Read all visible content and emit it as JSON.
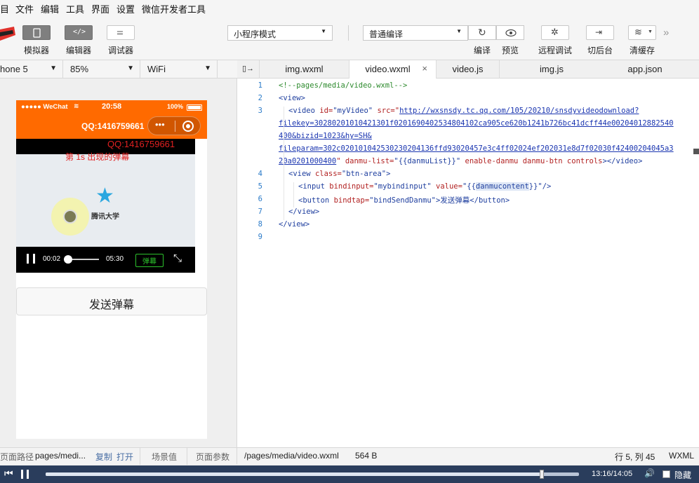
{
  "menubar": {
    "items": [
      "目",
      "文件",
      "编辑",
      "工具",
      "界面",
      "设置",
      "微信开发者工具"
    ]
  },
  "toolbar": {
    "simulator_label": "模拟器",
    "editor_label": "编辑器",
    "debugger_label": "调试器",
    "mode_select": "小程序模式",
    "compile_select": "普通编译",
    "compile_label": "编译",
    "preview_label": "预览",
    "remote_debug_label": "远程调试",
    "background_label": "切后台",
    "clear_cache_label": "清缓存"
  },
  "devbar": {
    "device": "hone 5",
    "zoom": "85%",
    "network": "WiFi"
  },
  "tabs": [
    "img.wxml",
    "video.wxml",
    "video.js",
    "img.js",
    "app.json"
  ],
  "phone": {
    "carrier": "●●●●● WeChat",
    "time": "20:58",
    "battery": "100%",
    "nav_title": "QQ:1416759661",
    "watermark": "QQ:1416759661",
    "danmu_text": "第 1s 出现的弹幕",
    "logo_text": "腾讯大学",
    "current_time": "00:02",
    "duration": "05:30",
    "danmu_btn": "弹幕",
    "send_button": "发送弹幕"
  },
  "editor": {
    "line_numbers": [
      "1",
      "2",
      "3",
      "4",
      "5",
      "6",
      "7",
      "8",
      "9"
    ],
    "l1": "<!--pages/media/video.wxml-->",
    "l2": "<view>",
    "l3_pre": "<video ",
    "l3_a1": "id=",
    "l3_v1": "\"myVideo\"",
    "l3_a2": " src=\"",
    "l3_url1": "http://wxsnsdy.tc.qq.com/105/20210/snsdyvideodownload?",
    "l3_url2": "filekey=30280201010421301f0201690402534804102ca905ce620b1241b726bc41dcff44e00204012882540",
    "l3_url3": "400&bizid=1023&hy=SH&",
    "l3_url4": "fileparam=302c020101042530230204136ffd93020457e3c4ff02024ef202031e8d7f02030f42400204045a3",
    "l3_url5": "20a0201000400",
    "l3_a3": "\" danmu-list=",
    "l3_v3": "\"{{danmuList}}\"",
    "l3_a4": " enable-danmu danmu-btn controls",
    "l3_end": "></video>",
    "l4_pre": "<view ",
    "l4_a": "class=",
    "l4_v": "\"btn-area\"",
    "l4_end": ">",
    "l5_pre": "<input ",
    "l5_a1": "bindinput=",
    "l5_v1": "\"mybindinput\"",
    "l5_a2": " value=",
    "l5_v2a": "\"{{",
    "l5_v2b": "danmucontent",
    "l5_v2c": "}}\"",
    "l5_end": "/>",
    "l6_pre": "<button ",
    "l6_a": "bindtap=",
    "l6_v": "\"bindSendDanmu\"",
    "l6_text": ">发送弹幕</button>",
    "l7": "</view>",
    "l8": "</view>"
  },
  "pathbar": {
    "label": "页面路径",
    "path": "pages/medi...",
    "copy": "复制",
    "open": "打开",
    "scene": "场景值",
    "params": "页面参数"
  },
  "infobar": {
    "file": "/pages/media/video.wxml",
    "size": "564 B",
    "position": "行 5, 列 45",
    "lang": "WXML"
  },
  "player": {
    "time": "13:16/14:05",
    "hide": "隐藏",
    "progress": 0.93
  }
}
